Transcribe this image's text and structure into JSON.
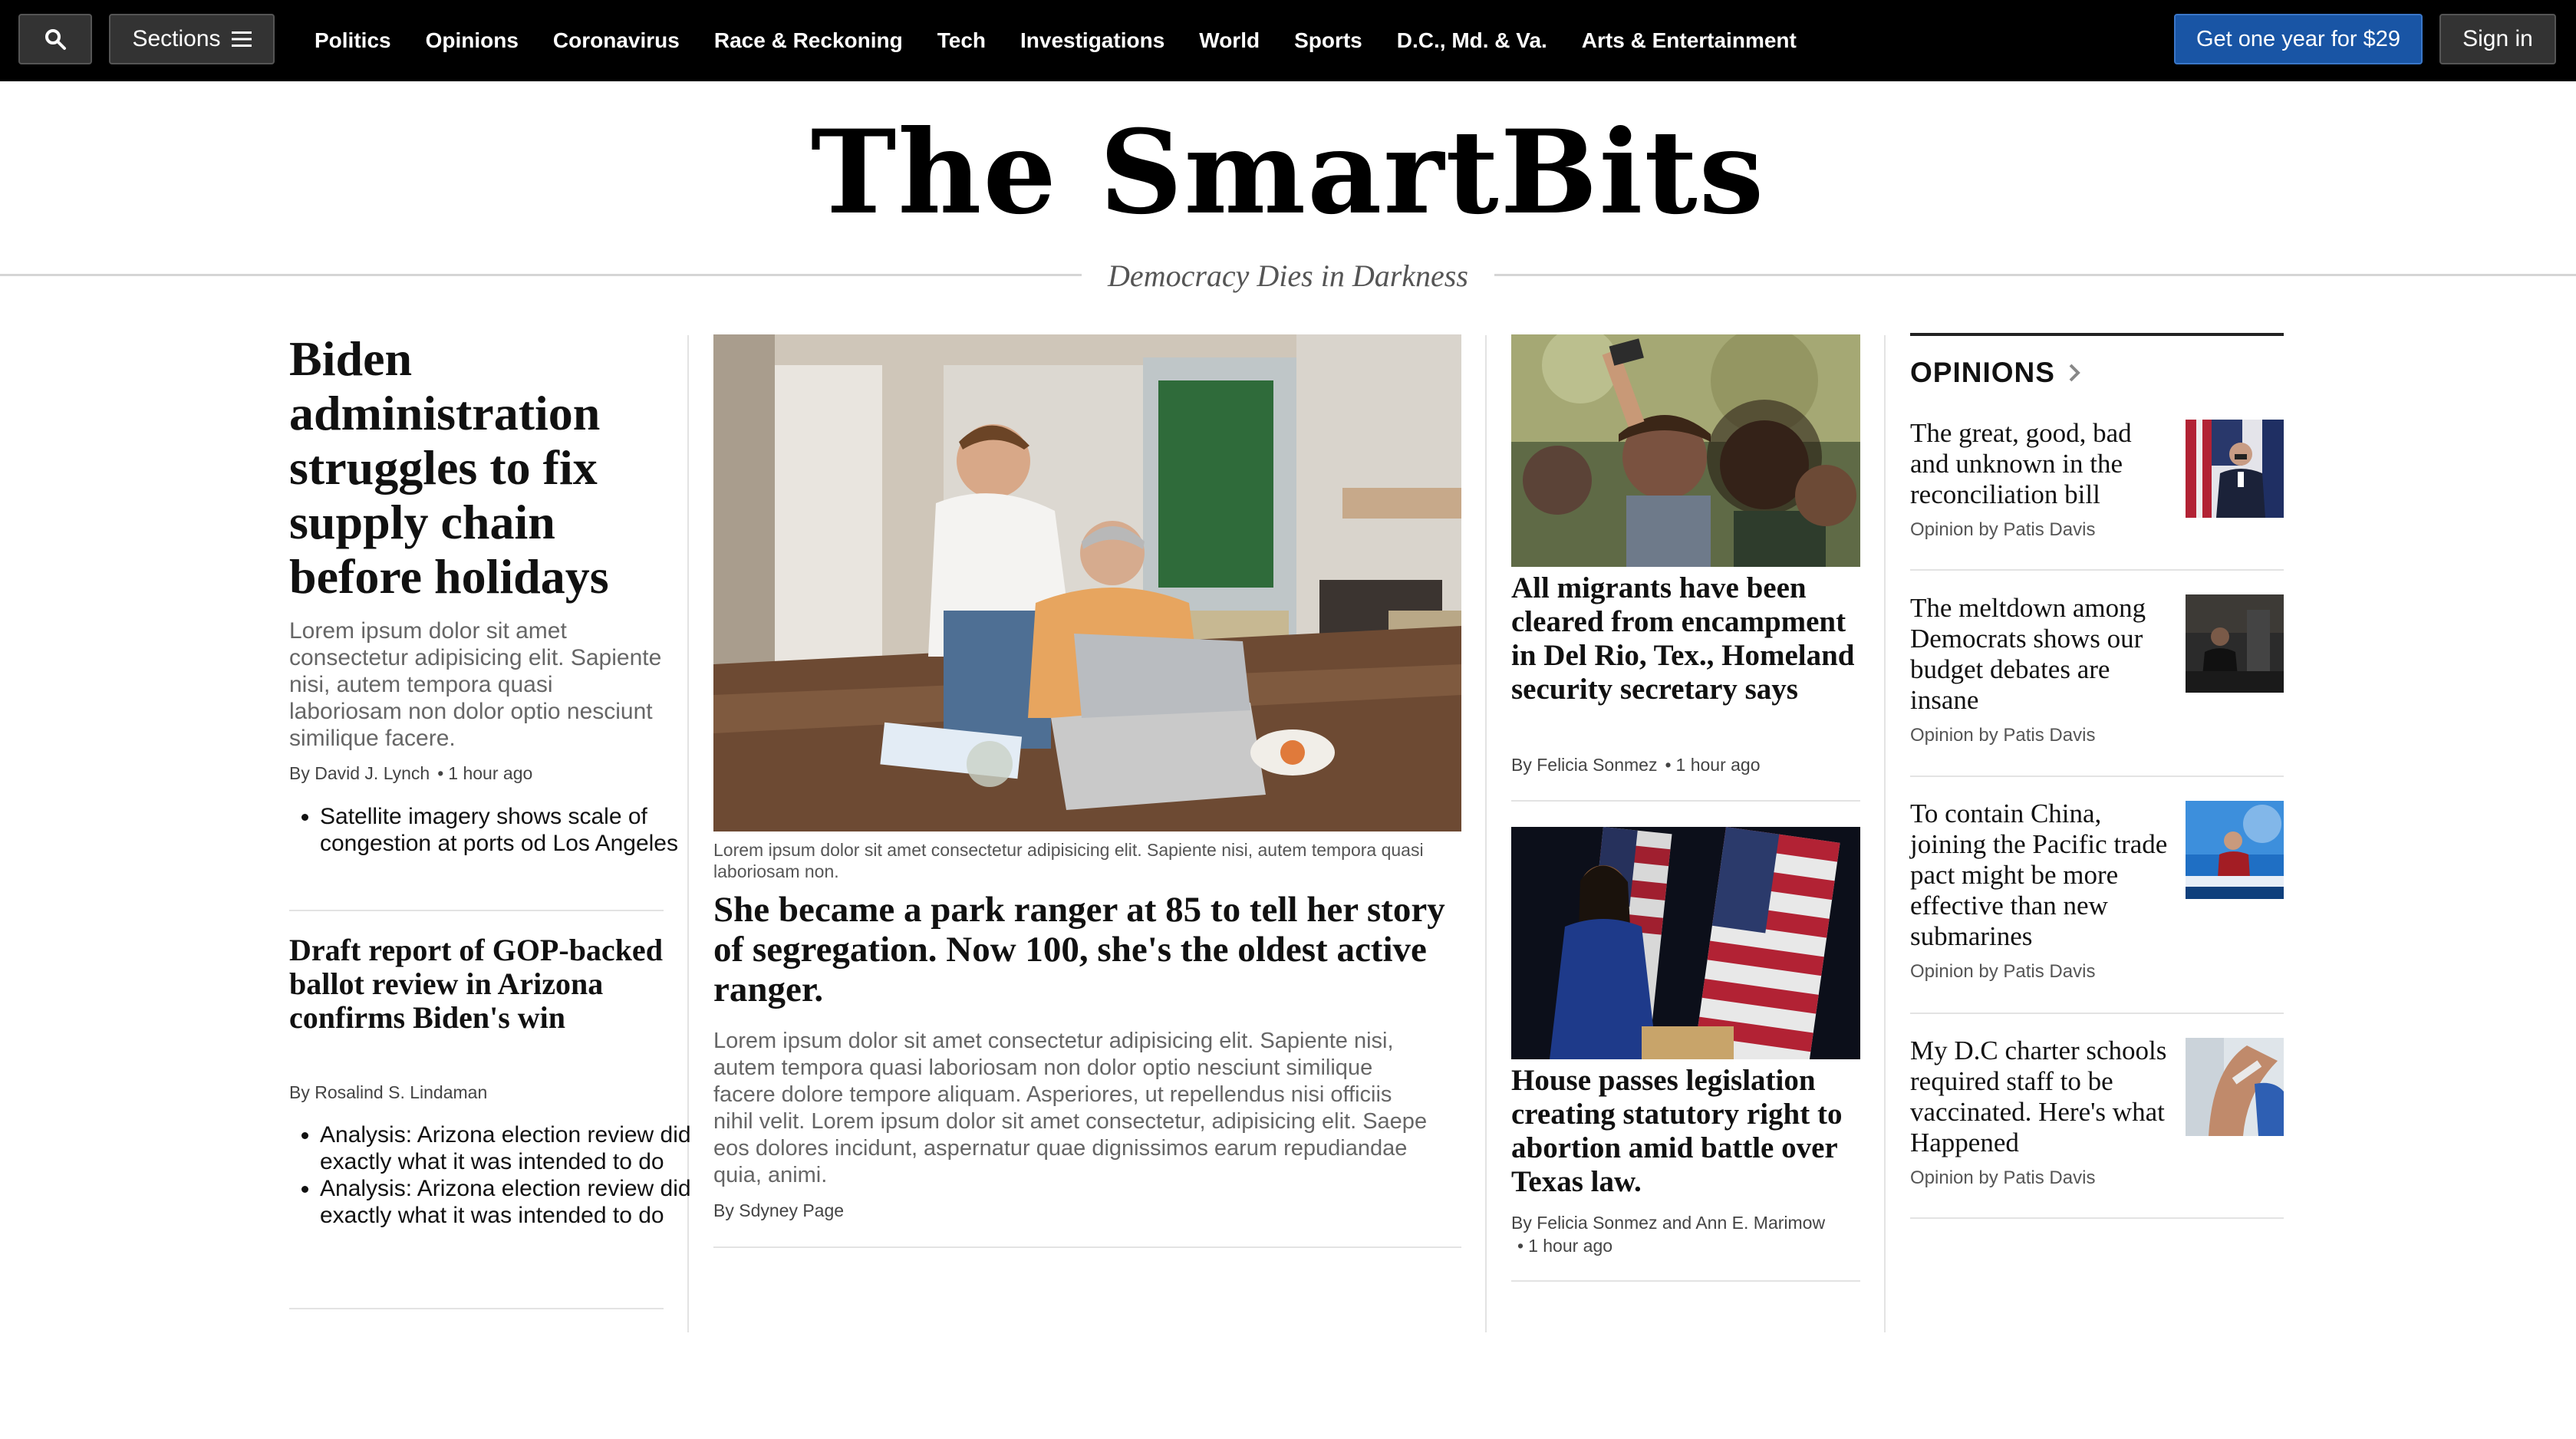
{
  "nav": {
    "sections_label": "Sections",
    "links": [
      "Politics",
      "Opinions",
      "Coronavirus",
      "Race & Reckoning",
      "Tech",
      "Investigations",
      "World",
      "Sports",
      "D.C., Md. & Va.",
      "Arts & Entertainment"
    ],
    "subscribe_label": "Get one year for $29",
    "signin_label": "Sign in",
    "icons": {
      "search": "search-icon",
      "menu": "hamburger-menu-icon"
    }
  },
  "masthead": {
    "name": "The SmartBits",
    "tagline": "Democracy Dies in Darkness"
  },
  "left": {
    "lead_headline": "Biden administration struggles to fix supply chain before holidays",
    "lead_blurb": "Lorem ipsum dolor sit amet consectetur adipisicing elit. Sapiente nisi, autem tempora quasi laboriosam non dolor optio nesciunt similique facere.",
    "lead_author": "By David J. Lynch",
    "lead_time": "1 hour ago",
    "lead_bullets": [
      "Satellite imagery shows scale of congestion at ports od Los Angeles"
    ],
    "second_headline": "Draft report of GOP-backed ballot review in Arizona confirms Biden's win",
    "second_author": "By Rosalind S. Lindaman",
    "second_bullets": [
      "Analysis: Arizona election review did exactly what it was intended to do",
      "Analysis: Arizona election review did exactly what it was intended to do"
    ]
  },
  "center": {
    "image_alt": "Two men looking at a laptop at a wooden table",
    "caption": "Lorem ipsum dolor sit amet consectetur adipisicing elit. Sapiente nisi, autem tempora quasi laboriosam non.",
    "headline": "She became a park ranger at 85 to tell her story of segregation. Now 100, she's the oldest active ranger.",
    "blurb": "Lorem ipsum dolor sit amet consectetur adipisicing elit. Sapiente nisi, autem tempora quasi laboriosam non dolor optio nesciunt similique facere dolore tempore aliquam. Asperiores, ut repellendus nisi officiis nihil velit. Lorem ipsum dolor sit amet consectetur, adipisicing elit. Saepe eos dolores incidunt, aspernatur quae dignissimos earum repudiandae quia, animi.",
    "author": "By Sdyney Page"
  },
  "right": {
    "story1": {
      "headline": "All migrants have been cleared from encampment in Del Rio, Tex., Homeland security secretary says",
      "author": "By Felicia Sonmez",
      "time": "1 hour ago"
    },
    "story2": {
      "headline": "House passes legislation creating statutory right to abortion amid battle over Texas law.",
      "author": "By Felicia Sonmez and Ann E. Marimow",
      "time": "1 hour ago"
    }
  },
  "opinions": {
    "title": "OPINIONS",
    "items": [
      {
        "headline": "The great, good, bad and unknown in the reconciliation bill",
        "byline": "Opinion by Patis Davis"
      },
      {
        "headline": "The meltdown among Democrats shows our budget debates are insane",
        "byline": "Opinion by Patis Davis"
      },
      {
        "headline": "To contain China, joining the Pacific trade pact might be more effective than new submarines",
        "byline": "Opinion by Patis Davis"
      },
      {
        "headline": "My D.C charter schools required staff to be vaccinated. Here's what Happened",
        "byline": "Opinion by Patis Davis"
      }
    ]
  },
  "colors": {
    "nav_bg": "#000000",
    "subscribe_bg": "#1955a5",
    "rule": "#e3e3e3"
  }
}
